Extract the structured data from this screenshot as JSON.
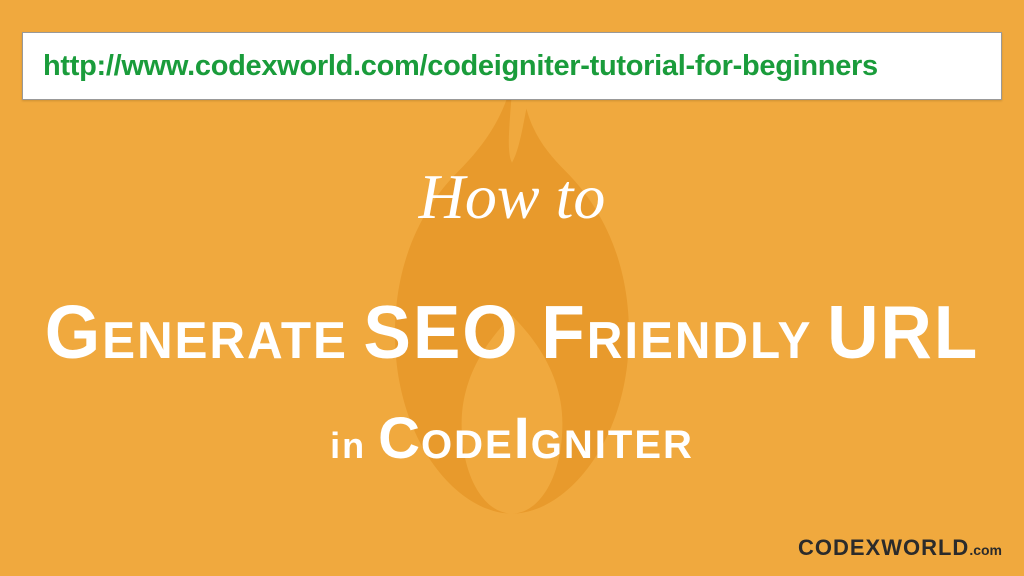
{
  "url_box": {
    "text": "http://www.codexworld.com/codeigniter-tutorial-for-beginners"
  },
  "content": {
    "howto": "How to",
    "headline_g": "G",
    "headline_enerate": "enerate ",
    "headline_seo": "SEO ",
    "headline_f": "F",
    "headline_riendly": "riendly ",
    "headline_url": "URL",
    "sub_in": "in ",
    "sub_c": "C",
    "sub_ode": "ode",
    "sub_i": "I",
    "sub_gniter": "gniter"
  },
  "brand": {
    "code": "CODE",
    "x": "X",
    "world": "WORLD",
    "com": ".com"
  },
  "colors": {
    "background": "#f0a93e",
    "flame": "#e89a2c",
    "url_text": "#1a9c3b",
    "text_white": "#ffffff",
    "brand_dark": "#2b2b2b"
  }
}
